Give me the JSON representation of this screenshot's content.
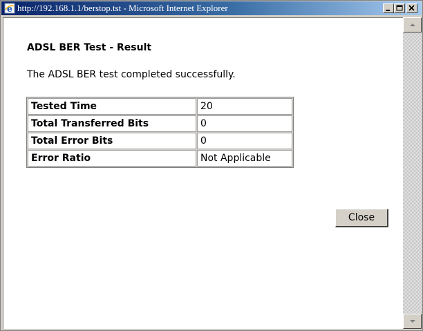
{
  "window": {
    "title": "http://192.168.1.1/berstop.tst - Microsoft Internet Explorer"
  },
  "page": {
    "heading": "ADSL BER Test - Result",
    "message": "The ADSL BER test completed successfully."
  },
  "results": [
    {
      "label": "Tested Time",
      "value": "20"
    },
    {
      "label": "Total Transferred Bits",
      "value": "0"
    },
    {
      "label": "Total Error Bits",
      "value": "0"
    },
    {
      "label": "Error Ratio",
      "value": "Not Applicable"
    }
  ],
  "actions": {
    "close_label": "Close"
  },
  "icons": {
    "app_icon": "internet-explorer-icon",
    "minimize": "minimize-icon",
    "maximize": "maximize-icon",
    "close": "close-icon",
    "scroll_up": "arrow-up-icon",
    "scroll_down": "arrow-down-icon"
  },
  "colors": {
    "titlebar_start": "#0a246a",
    "titlebar_end": "#a6caf0",
    "chrome": "#d4d0c8"
  }
}
